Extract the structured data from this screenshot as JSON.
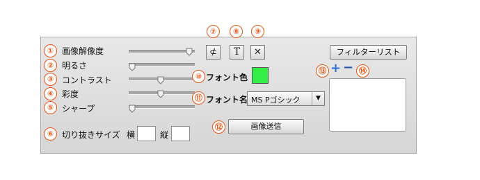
{
  "markers": [
    "①",
    "②",
    "③",
    "④",
    "⑤",
    "⑥",
    "⑦",
    "⑧",
    "⑨",
    "⑩",
    "⑪",
    "⑫",
    "⑬",
    "⑭"
  ],
  "sliders": [
    {
      "label": "画像解像度",
      "value": 0.97
    },
    {
      "label": "明るさ",
      "value": 0.0
    },
    {
      "label": "コントラスト",
      "value": 0.48
    },
    {
      "label": "彩度",
      "value": 0.48
    },
    {
      "label": "シャープ",
      "value": 0.0
    }
  ],
  "crop": {
    "label": "切り抜きサイズ",
    "width_label": "横",
    "height_label": "縦",
    "width_value": "",
    "height_value": ""
  },
  "tools": {
    "crop_glyph": "⊄",
    "text_glyph": "T",
    "close_glyph": "✕"
  },
  "font_color": {
    "label": "フォント色",
    "value": "#33ee44"
  },
  "font_name": {
    "label": "フォント名",
    "selected": "MS Pゴシック",
    "arrow": "▼"
  },
  "send_button": "画像送信",
  "filter_list_button": "フィルターリスト",
  "list_controls": {
    "add": "+",
    "remove": "−"
  },
  "colors": {
    "marker": "#e8520e",
    "add": "#2f6fd8",
    "remove": "#1f4fb3"
  }
}
